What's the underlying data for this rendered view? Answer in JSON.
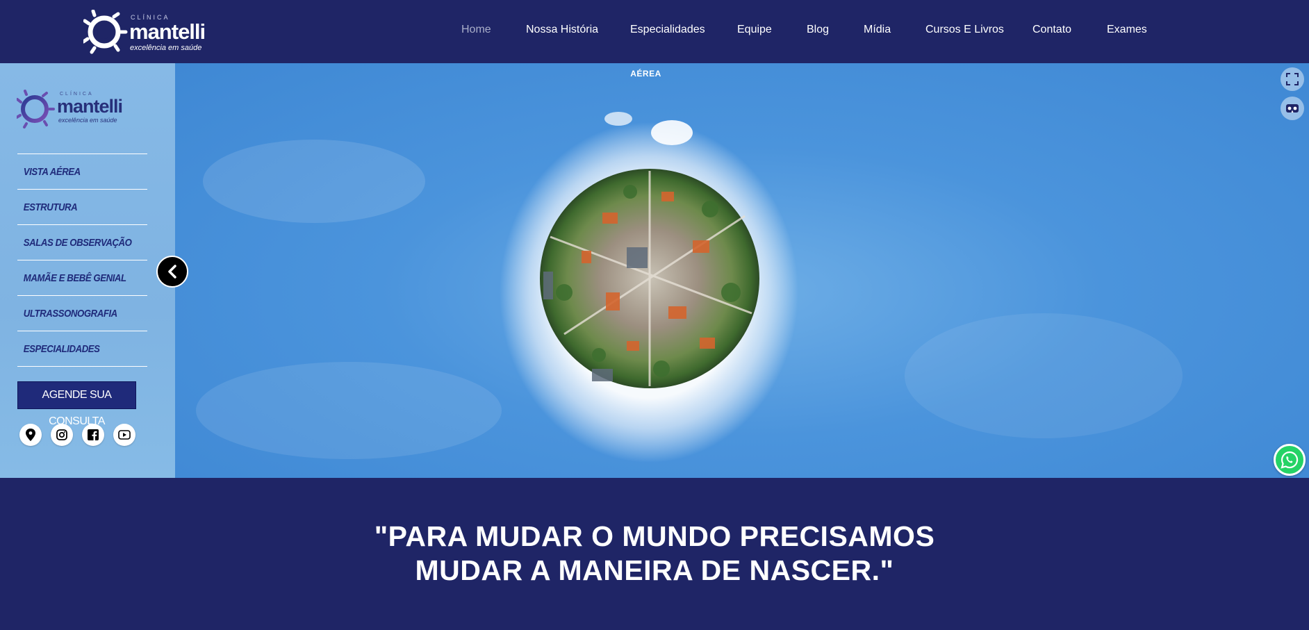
{
  "brand": {
    "small": "CLÍNICA",
    "name": "mantelli",
    "tagline": "excelência em saúde"
  },
  "nav": {
    "items": [
      "Home",
      "Nossa História",
      "Especialidades",
      "Equipe",
      "Blog",
      "Mídia",
      "Cursos E Livros",
      "Contato",
      "Exames"
    ],
    "active": "Home"
  },
  "sidebar": {
    "logo": {
      "small": "CLÍNICA",
      "name": "mantelli",
      "tagline": "excelência em saúde"
    },
    "menu": [
      "VISTA AÉREA",
      "ESTRUTURA",
      "SALAS DE OBSERVAÇÃO",
      "MAMÃE E BEBÊ GENIAL",
      "ULTRASSONOGRAFIA",
      "ESPECIALIDADES"
    ],
    "cta": "AGENDE SUA CONSULTA",
    "socials": [
      "map-pin-icon",
      "instagram-icon",
      "facebook-icon",
      "youtube-icon"
    ]
  },
  "pano": {
    "label": "AÉREA",
    "controls": [
      "fullscreen-icon",
      "vr-headset-icon"
    ],
    "prev_icon": "chevron-left-icon"
  },
  "quote": {
    "line1": "\"PARA MUDAR O MUNDO PRECISAMOS",
    "line2": "MUDAR A MANEIRA DE NASCER.\""
  },
  "colors": {
    "navy": "#1f2566",
    "sky": "#4b94dc",
    "sidebar": "#86b9e6",
    "menu_text": "#1f2a7a",
    "whatsapp": "#25d366"
  }
}
